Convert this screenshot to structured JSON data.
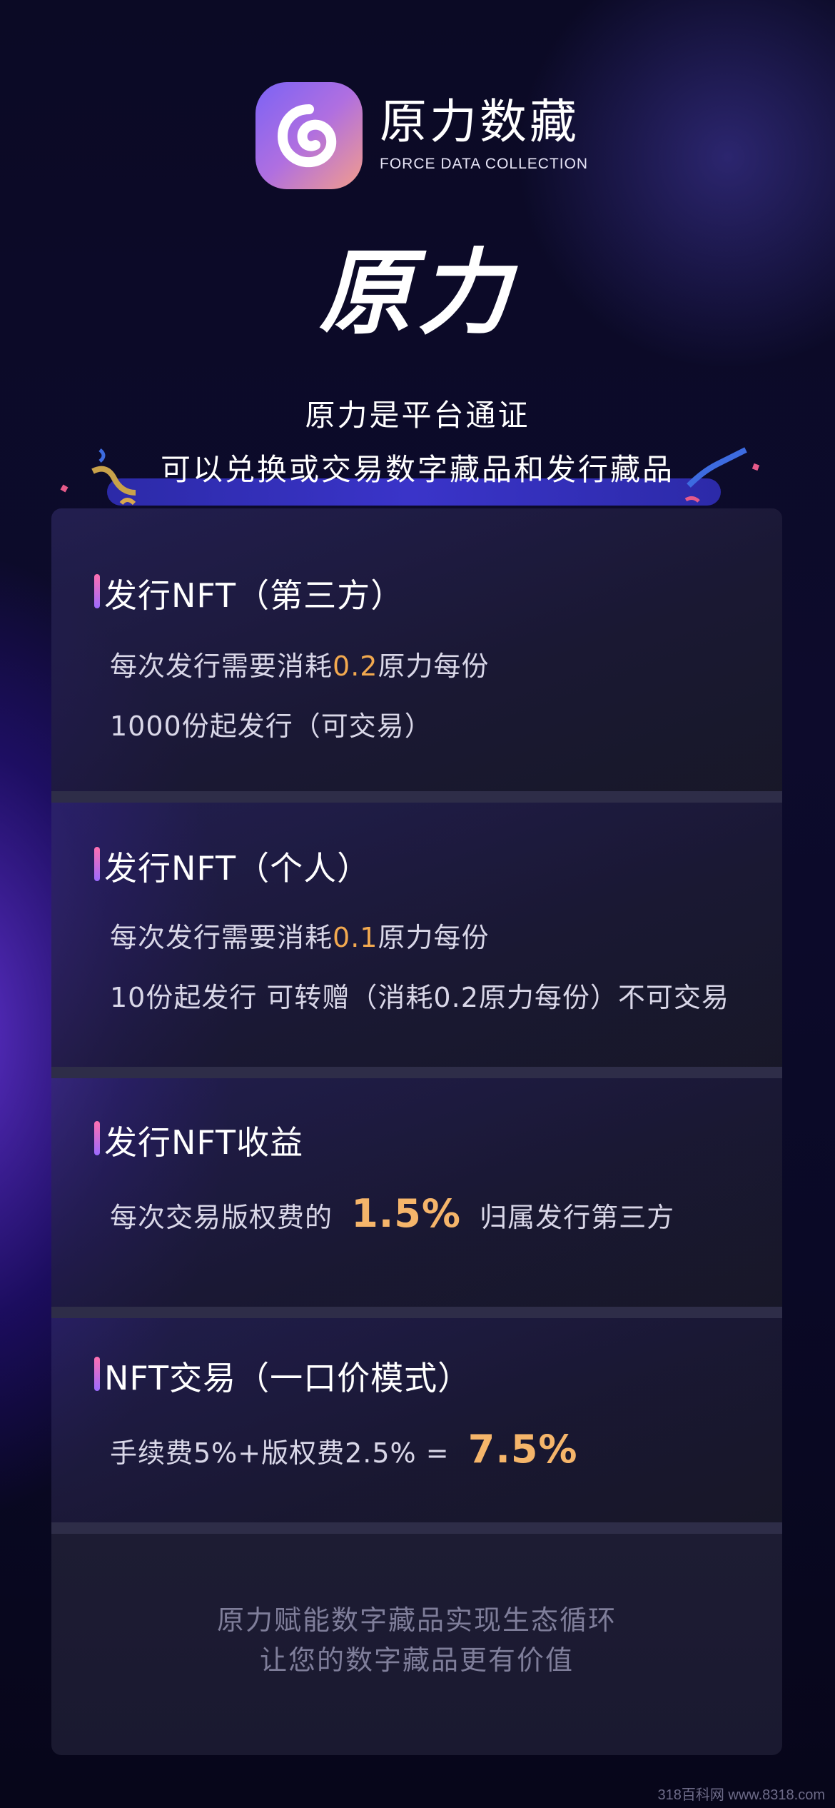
{
  "brand": {
    "name_cn": "原力数藏",
    "name_en": "FORCE DATA COLLECTION",
    "logo_icon": "swirl-logo-icon"
  },
  "hero": {
    "title": "原力",
    "subtitle_line1": "原力是平台通证",
    "subtitle_line2": "可以兑换或交易数字藏品和发行藏品"
  },
  "sections": [
    {
      "title": "发行NFT（第三方）",
      "line1_prefix": "每次发行需要消耗",
      "line1_value": "0.2",
      "line1_suffix": "原力每份",
      "line2": "1000份起发行（可交易）"
    },
    {
      "title": "发行NFT（个人）",
      "line1_prefix": "每次发行需要消耗",
      "line1_value": "0.1",
      "line1_suffix": "原力每份",
      "line2": "10份起发行 可转赠（消耗0.2原力每份）不可交易"
    },
    {
      "title": "发行NFT收益",
      "line1_prefix": "每次交易版权费的",
      "line1_value": "1.5%",
      "line1_suffix": "归属发行第三方"
    },
    {
      "title": "NFT交易（一口价模式）",
      "line1_prefix": "手续费5%+版权费2.5% =",
      "line1_value": "7.5%"
    }
  ],
  "footer": {
    "line1": "原力赋能数字藏品实现生态循环",
    "line2": "让您的数字藏品更有价值"
  },
  "watermark": "318百科网 www.8318.com",
  "colors": {
    "background": "#0b0a25",
    "accent_orange": "#f2a94f",
    "card": "#1d1c33",
    "logo_gradient_start": "#7b63f5",
    "logo_gradient_end": "#f39d8b"
  }
}
